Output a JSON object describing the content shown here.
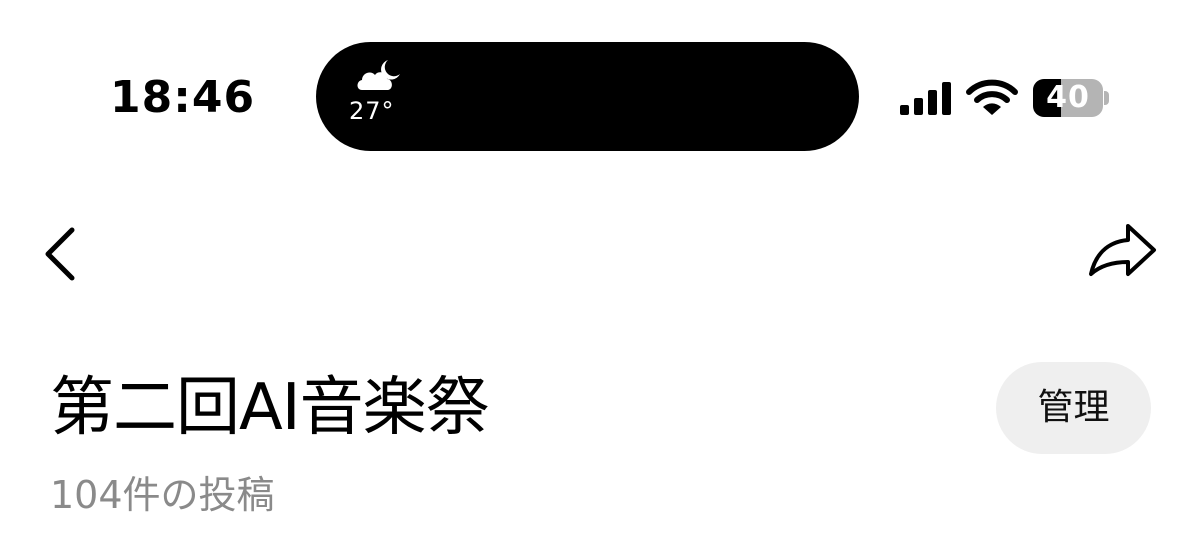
{
  "status_bar": {
    "time": "18:46",
    "weather": {
      "icon": "partly-cloudy-night-icon",
      "temperature": "27°"
    },
    "signal": {
      "icon": "cellular-signal-icon",
      "bars": 4
    },
    "wifi": {
      "icon": "wifi-icon"
    },
    "battery": {
      "icon": "battery-icon",
      "level_text": "40",
      "level_fraction": 0.4
    }
  },
  "nav_bar": {
    "back_icon": "chevron-left-icon",
    "share_icon": "share-arrow-icon"
  },
  "header": {
    "title": "第二回AI音楽祭",
    "post_count": "104件の投稿",
    "manage_label": "管理"
  },
  "colors": {
    "background": "#ffffff",
    "text": "#000000",
    "secondary_text": "#8a8a8a",
    "button_bg": "#efefef",
    "island": "#000000",
    "battery_empty": "#b4b4b4"
  }
}
